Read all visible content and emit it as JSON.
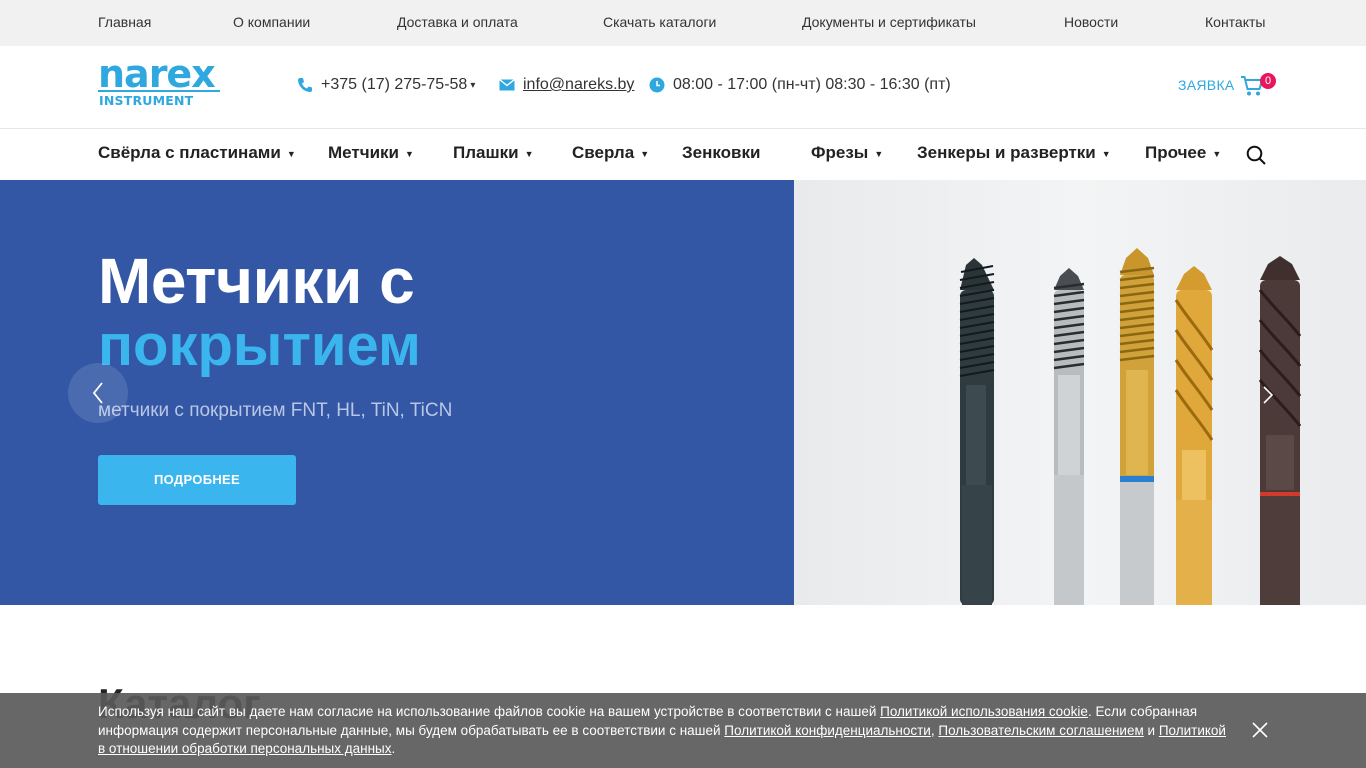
{
  "topbar": {
    "items": [
      "Главная",
      "О компании",
      "Доставка и оплата",
      "Скачать каталоги",
      "Документы и сертификаты",
      "Новости",
      "Контакты"
    ]
  },
  "logo": {
    "word": "narex",
    "sub": "INSTRUMENT"
  },
  "header": {
    "phone": "+375 (17) 275-75-58",
    "email": "info@nareks.by",
    "hours": "08:00 - 17:00 (пн-чт) 08:30 - 16:30 (пт)",
    "request_label": "ЗАЯВКА",
    "cart_count": "0"
  },
  "nav": {
    "items": [
      "Свёрла с пластинами",
      "Метчики",
      "Плашки",
      "Сверла",
      "Зенковки",
      "Фрезы",
      "Зенкеры и развертки",
      "Прочее"
    ]
  },
  "hero": {
    "title_line1": "Метчики с",
    "title_line2": "покрытием",
    "subtitle": "метчики с покрытием FNT, HL, TiN, TiCN",
    "button": "ПОДРОБНЕЕ"
  },
  "catalog": {
    "title": "Каталог"
  },
  "cookie": {
    "t1": "Используя наш сайт вы даете нам согласие на использование файлов cookie на вашем устройстве в соответствии с нашей ",
    "l1": "Политикой использования cookie",
    "t2": ". Если собранная информация содержит персональные данные, мы будем обрабатывать ее в соответствии с нашей ",
    "l2": "Политикой конфиденциальности",
    "t3": ", ",
    "l3": "Пользовательским соглашением",
    "t4": " и ",
    "l4": "Политикой в отношении обработки персональных данных",
    "t5": "."
  },
  "colors": {
    "brand": "#2fa8e0",
    "hero_bg": "#3357a5",
    "accent": "#3ab5ee",
    "badge": "#e8175d"
  }
}
